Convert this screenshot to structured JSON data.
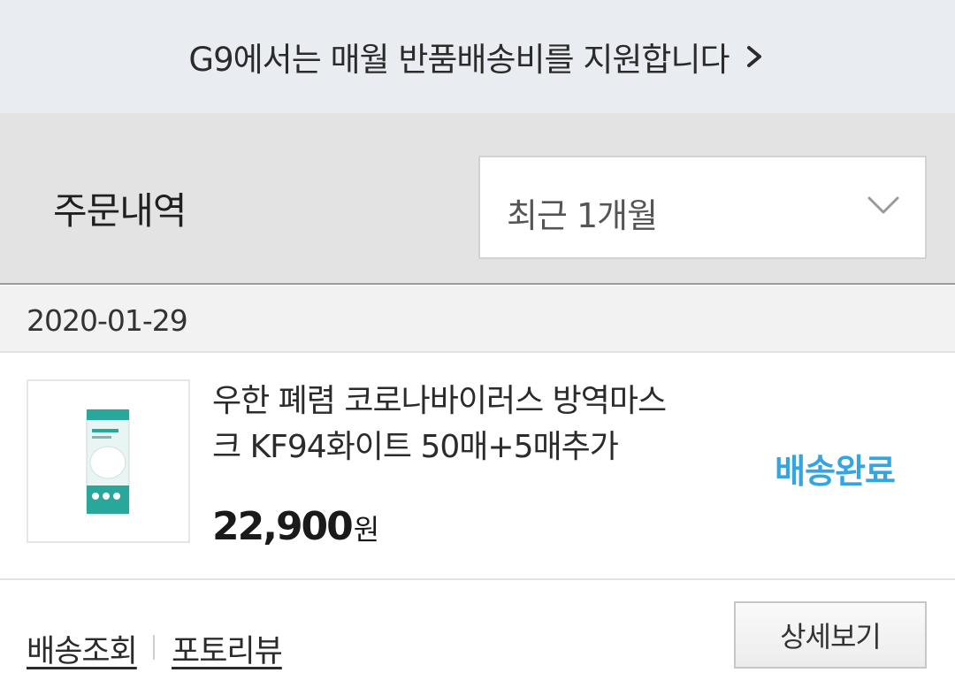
{
  "banner": {
    "text": "G9에서는 매월 반품배송비를 지원합니다",
    "icon": "chevron-right-icon"
  },
  "filter": {
    "title": "주문내역",
    "period": {
      "selected": "최근 1개월",
      "icon": "chevron-down-icon"
    }
  },
  "orders": [
    {
      "date": "2020-01-29",
      "product": {
        "name": "우한 폐렴 코로나바이러스 방역마스크 KF94화이트 50매+5매추가",
        "price": "22,900",
        "currency": "원"
      },
      "status": "배송완료",
      "actions": {
        "track_label": "배송조회",
        "review_label": "포토리뷰",
        "detail_label": "상세보기"
      }
    }
  ],
  "colors": {
    "status": "#35a4e0",
    "banner_bg": "#e9edf1",
    "filter_bg": "#e3e3e3"
  }
}
